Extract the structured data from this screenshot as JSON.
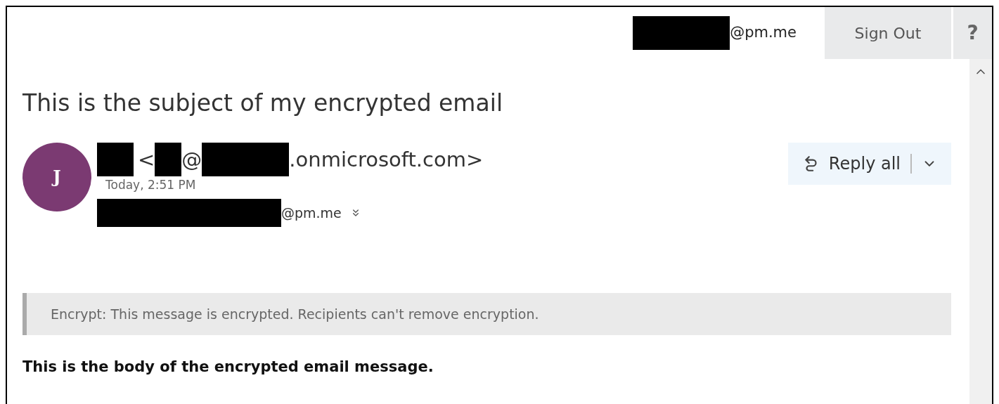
{
  "account": {
    "email_suffix": "@pm.me"
  },
  "sign_out": "Sign Out",
  "help": "?",
  "subject": "This is the subject of my encrypted email",
  "sender": {
    "avatar_initial": "J",
    "address_open": "<",
    "at": "@",
    "domain": ".onmicrosoft.com>",
    "time": "Today, 2:51 PM",
    "recipient_suffix": "@pm.me"
  },
  "reply_all": "Reply all",
  "banner": "Encrypt: This message is encrypted. Recipients can't remove encryption.",
  "body": "This is the body of the encrypted email message."
}
